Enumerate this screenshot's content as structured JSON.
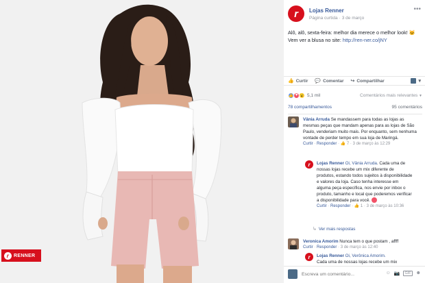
{
  "photo": {
    "brand_tag": "RENNER",
    "brand_tag_letter": "r"
  },
  "post": {
    "page_logo_letter": "r",
    "page_name": "Lojas Renner",
    "page_type": "Página curtida",
    "date": "3 de março",
    "more": "•••",
    "text_1": "Alô, alô, sexta-feira: melhor dia merece o melhor look! ",
    "text_emoji": "🐱",
    "text_2": " Vem ver a blusa no site: ",
    "link": "http://ren-ner.co/jNY"
  },
  "actions": {
    "like": "Curtir",
    "comment": "Comentar",
    "share": "Compartilhar",
    "like_icon": "👍",
    "comment_icon": "💬",
    "share_icon": "↪",
    "share_pic_icon": "▾"
  },
  "reactions": {
    "count": "5,1 mil",
    "sort": "Comentários mais relevantes",
    "sort_caret": "▼",
    "like": "👍",
    "love": "♥",
    "wow": "😮"
  },
  "counts": {
    "shares": "78 compartilhamentos",
    "comments": "95 comentários"
  },
  "comment_1": {
    "name": "Vânia Arruda",
    "text": " Se mandassem para todas as lojas as mesmas peças que mandam apenas para as lojas de São Paulo, venderiam muito mais. Por enquanto, sem nenhuma vontade de perder tempo em sua loja de Maringá.",
    "like": "Curtir",
    "reply": "Responder",
    "likes": "7",
    "time": "3 de março às 12:29"
  },
  "reply_1": {
    "avatar_letter": "r",
    "name": "Lojas Renner",
    "mention": "Oi, Vânia Arruda",
    "text": ". Cada uma de nossas lojas recebe um mix diferente de produtos, estando todos sujeitos à disponibilidade e valores da loja. Caso tenha interesse em alguma peça específica, nos envie por inbox o produto, tamanho e local que poderemos verificar a disponibilidade para você. ",
    "like": "Curtir",
    "reply": "Responder",
    "likes": "1",
    "time": "3 de março às 10:36"
  },
  "more_replies": {
    "arrow": "↳",
    "label": "Ver mais respostas"
  },
  "comment_2": {
    "name": "Veronica Amorim",
    "text": " Nunca tem o que postam , affff",
    "like": "Curtir",
    "reply": "Responder",
    "time": "3 de março às 12:40"
  },
  "reply_2": {
    "avatar_letter": "r",
    "name": "Lojas Renner",
    "mention": "Oi, Verônica Amorim.",
    "text": "Cada uma de nossas lojas recebe um mix"
  },
  "composer": {
    "placeholder": "Escreva um comentário...",
    "emoji": "☺",
    "camera": "📷",
    "gif": "GIF",
    "sticker": "☻"
  }
}
